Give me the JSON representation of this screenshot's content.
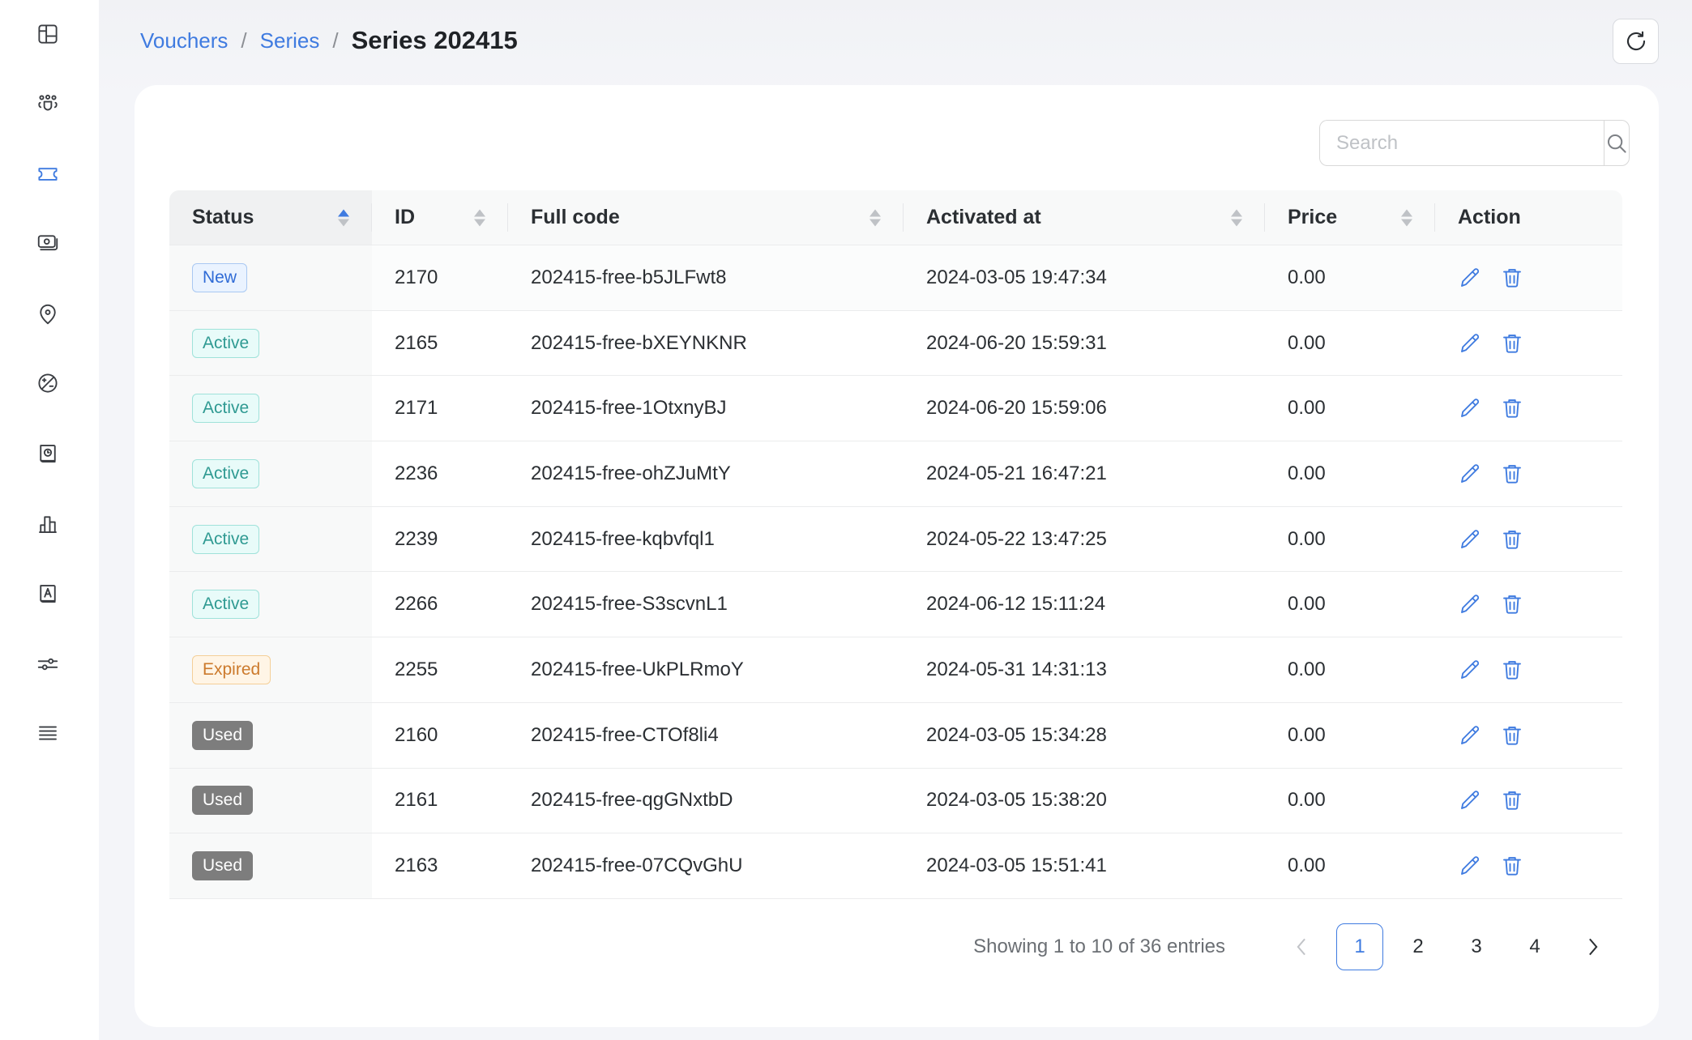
{
  "sidebar": {
    "items": [
      {
        "icon": "dashboard-layout-icon",
        "active": false
      },
      {
        "icon": "users-group-icon",
        "active": false
      },
      {
        "icon": "ticket-voucher-icon",
        "active": true
      },
      {
        "icon": "money-cash-icon",
        "active": false
      },
      {
        "icon": "location-pin-icon",
        "active": false
      },
      {
        "icon": "discount-percent-icon",
        "active": false
      },
      {
        "icon": "log-book-clock-icon",
        "active": false
      },
      {
        "icon": "bar-chart-icon",
        "active": false
      },
      {
        "icon": "font-book-icon",
        "active": false
      },
      {
        "icon": "sliders-settings-icon",
        "active": false
      },
      {
        "icon": "menu-lines-icon",
        "active": false
      }
    ]
  },
  "breadcrumb": {
    "items": [
      "Vouchers",
      "Series"
    ],
    "separator": "/",
    "current": "Series 202415"
  },
  "toolbar": {
    "refresh_icon": "refresh-icon"
  },
  "search": {
    "placeholder": "Search",
    "value": ""
  },
  "colors": {
    "accent": "#3f7be0",
    "new": "#2f6bd6",
    "active": "#2f9a92",
    "expired": "#cc7a2c",
    "used": "#7d7d7d"
  },
  "table": {
    "columns": [
      {
        "label": "Status",
        "sortable": true,
        "sort": "asc"
      },
      {
        "label": "ID",
        "sortable": true
      },
      {
        "label": "Full code",
        "sortable": true
      },
      {
        "label": "Activated at",
        "sortable": true
      },
      {
        "label": "Price",
        "sortable": true
      },
      {
        "label": "Action",
        "sortable": false
      }
    ],
    "rows": [
      {
        "status": "New",
        "id": "2170",
        "code": "202415-free-b5JLFwt8",
        "activated": "2024-03-05 19:47:34",
        "price": "0.00"
      },
      {
        "status": "Active",
        "id": "2165",
        "code": "202415-free-bXEYNKNR",
        "activated": "2024-06-20 15:59:31",
        "price": "0.00"
      },
      {
        "status": "Active",
        "id": "2171",
        "code": "202415-free-1OtxnyBJ",
        "activated": "2024-06-20 15:59:06",
        "price": "0.00"
      },
      {
        "status": "Active",
        "id": "2236",
        "code": "202415-free-ohZJuMtY",
        "activated": "2024-05-21 16:47:21",
        "price": "0.00"
      },
      {
        "status": "Active",
        "id": "2239",
        "code": "202415-free-kqbvfql1",
        "activated": "2024-05-22 13:47:25",
        "price": "0.00"
      },
      {
        "status": "Active",
        "id": "2266",
        "code": "202415-free-S3scvnL1",
        "activated": "2024-06-12 15:11:24",
        "price": "0.00"
      },
      {
        "status": "Expired",
        "id": "2255",
        "code": "202415-free-UkPLRmoY",
        "activated": "2024-05-31 14:31:13",
        "price": "0.00"
      },
      {
        "status": "Used",
        "id": "2160",
        "code": "202415-free-CTOf8li4",
        "activated": "2024-03-05 15:34:28",
        "price": "0.00"
      },
      {
        "status": "Used",
        "id": "2161",
        "code": "202415-free-qgGNxtbD",
        "activated": "2024-03-05 15:38:20",
        "price": "0.00"
      },
      {
        "status": "Used",
        "id": "2163",
        "code": "202415-free-07CQvGhU",
        "activated": "2024-03-05 15:51:41",
        "price": "0.00"
      }
    ],
    "row_actions": [
      "edit-icon",
      "delete-icon"
    ]
  },
  "pagination": {
    "info": "Showing 1 to 10 of 36 entries",
    "pages": [
      "1",
      "2",
      "3",
      "4"
    ],
    "current": "1",
    "prev": "‹",
    "next": "›"
  }
}
